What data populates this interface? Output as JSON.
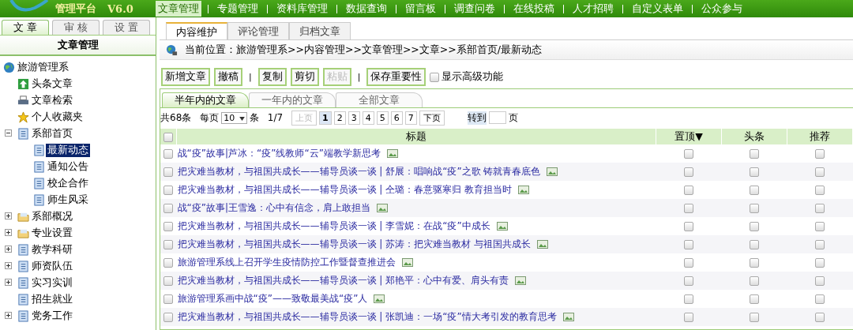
{
  "header": {
    "title": "管理平台",
    "version": "V6.0"
  },
  "nav": [
    {
      "label": "文章管理",
      "selected": true
    },
    {
      "label": "专题管理",
      "selected": false
    },
    {
      "label": "资料库管理",
      "selected": false
    },
    {
      "label": "数据查询",
      "selected": false
    },
    {
      "label": "留言板",
      "selected": false
    },
    {
      "label": "调查问卷",
      "selected": false
    },
    {
      "label": "在线投稿",
      "selected": false
    },
    {
      "label": "人才招聘",
      "selected": false
    },
    {
      "label": "自定义表单",
      "selected": false
    },
    {
      "label": "公众参与",
      "selected": false
    }
  ],
  "sidebar": {
    "tabs": [
      {
        "label": "文 章",
        "selected": true
      },
      {
        "label": "审 核",
        "selected": false
      },
      {
        "label": "设 置",
        "selected": false
      }
    ],
    "heading": "文章管理",
    "tree": {
      "label": "旅游管理系",
      "kind": "globe",
      "selected": false,
      "children": [
        {
          "label": "头条文章",
          "kind": "arrow",
          "selected": false
        },
        {
          "label": "文章检索",
          "kind": "printer",
          "selected": false
        },
        {
          "label": "个人收藏夹",
          "kind": "star",
          "selected": false
        },
        {
          "label": "系部首页",
          "kind": "doc",
          "selected": false,
          "expanded": true,
          "children": [
            {
              "label": "最新动态",
              "kind": "doc",
              "selected": true
            },
            {
              "label": "通知公告",
              "kind": "doc",
              "selected": false
            },
            {
              "label": "校企合作",
              "kind": "doc",
              "selected": false
            },
            {
              "label": "师生风采",
              "kind": "doc",
              "selected": false
            }
          ]
        },
        {
          "label": "系部概况",
          "kind": "folder",
          "selected": false,
          "expanded": false
        },
        {
          "label": "专业设置",
          "kind": "folder",
          "selected": false,
          "expanded": false
        },
        {
          "label": "教学科研",
          "kind": "doc",
          "selected": false,
          "expanded": false
        },
        {
          "label": "师资队伍",
          "kind": "doc",
          "selected": false,
          "expanded": false
        },
        {
          "label": "实习实训",
          "kind": "doc",
          "selected": false,
          "expanded": false
        },
        {
          "label": "招生就业",
          "kind": "doc",
          "selected": false
        },
        {
          "label": "党务工作",
          "kind": "doc",
          "selected": false,
          "expanded": false
        }
      ]
    }
  },
  "content_tabs": [
    {
      "label": "内容维护",
      "selected": true
    },
    {
      "label": "评论管理",
      "selected": false
    },
    {
      "label": "归档文章",
      "selected": false
    }
  ],
  "breadcrumb": "当前位置：旅游管理系>>内容管理>>文章管理>>文章>>系部首页/最新动态",
  "toolbar": [
    {
      "kind": "button",
      "label": "新增文章",
      "disabled": false
    },
    {
      "kind": "button",
      "label": "撤稿",
      "disabled": false
    },
    {
      "kind": "separator",
      "label": "|"
    },
    {
      "kind": "button",
      "label": "复制",
      "disabled": false
    },
    {
      "kind": "button",
      "label": "剪切",
      "disabled": false
    },
    {
      "kind": "button",
      "label": "粘贴",
      "disabled": true
    },
    {
      "kind": "separator",
      "label": "|"
    },
    {
      "kind": "button",
      "label": "保存重要性",
      "disabled": false
    },
    {
      "kind": "checkbox",
      "label": "显示高级功能",
      "checked": false
    }
  ],
  "period_tabs": [
    {
      "label": "半年内的文章",
      "selected": true
    },
    {
      "label": "一年内的文章",
      "selected": false
    },
    {
      "label": "全部文章",
      "selected": false
    }
  ],
  "pager": {
    "total": "共68条",
    "per_page_label": "每页",
    "per_page": "10",
    "per_page_unit": "条",
    "position": "1/7",
    "prev": {
      "label": "上页",
      "disabled": true
    },
    "pages": [
      {
        "label": "1",
        "selected": true
      },
      {
        "label": "2",
        "selected": false
      },
      {
        "label": "3",
        "selected": false
      },
      {
        "label": "4",
        "selected": false
      },
      {
        "label": "5",
        "selected": false
      },
      {
        "label": "6",
        "selected": false
      },
      {
        "label": "7",
        "selected": false
      }
    ],
    "next": {
      "label": "下页",
      "disabled": false
    },
    "goto_label": "转到",
    "goto_unit": "页"
  },
  "table": {
    "select_all": false,
    "columns": [
      "标题",
      "置顶▼",
      "头条",
      "推荐"
    ],
    "rows": [
      {
        "checked": false,
        "title": "战“疫”故事|芦冰：“疫”线教师“云”端教学新思考",
        "has_image": true,
        "pinned": false,
        "headline": false,
        "recommended": false
      },
      {
        "checked": false,
        "title": "把灾难当教材，与祖国共成长——辅导员谈一谈 | 舒展：唱响战“疫”之歌 铸就青春底色",
        "has_image": true,
        "pinned": false,
        "headline": false,
        "recommended": false
      },
      {
        "checked": false,
        "title": "把灾难当教材，与祖国共成长——辅导员谈一谈 | 仝璐：春意驱寒归 教育担当时",
        "has_image": true,
        "pinned": false,
        "headline": false,
        "recommended": false
      },
      {
        "checked": false,
        "title": "战“疫”故事|王雪逸：心中有信念，肩上敢担当",
        "has_image": true,
        "pinned": false,
        "headline": false,
        "recommended": false
      },
      {
        "checked": false,
        "title": "把灾难当教材，与祖国共成长——辅导员谈一谈 | 李雪妮：在战“疫”中成长",
        "has_image": true,
        "pinned": false,
        "headline": false,
        "recommended": false
      },
      {
        "checked": false,
        "title": "把灾难当教材，与祖国共成长——辅导员谈一谈 | 苏涛：把灾难当教材 与祖国共成长",
        "has_image": true,
        "pinned": false,
        "headline": false,
        "recommended": false
      },
      {
        "checked": false,
        "title": "旅游管理系线上召开学生疫情防控工作暨督查推进会",
        "has_image": true,
        "pinned": false,
        "headline": false,
        "recommended": false
      },
      {
        "checked": false,
        "title": "把灾难当教材，与祖国共成长——辅导员谈一谈 | 郑艳平：心中有爱、肩头有责",
        "has_image": true,
        "pinned": false,
        "headline": false,
        "recommended": false
      },
      {
        "checked": false,
        "title": "旅游管理系画中战“疫”——致敬最美战“疫”人",
        "has_image": true,
        "pinned": false,
        "headline": false,
        "recommended": false
      },
      {
        "checked": false,
        "title": "把灾难当教材，与祖国共成长——辅导员谈一谈 | 张凯迪：一场“疫”情大考引发的教育思考",
        "has_image": true,
        "pinned": false,
        "headline": false,
        "recommended": false
      }
    ]
  }
}
